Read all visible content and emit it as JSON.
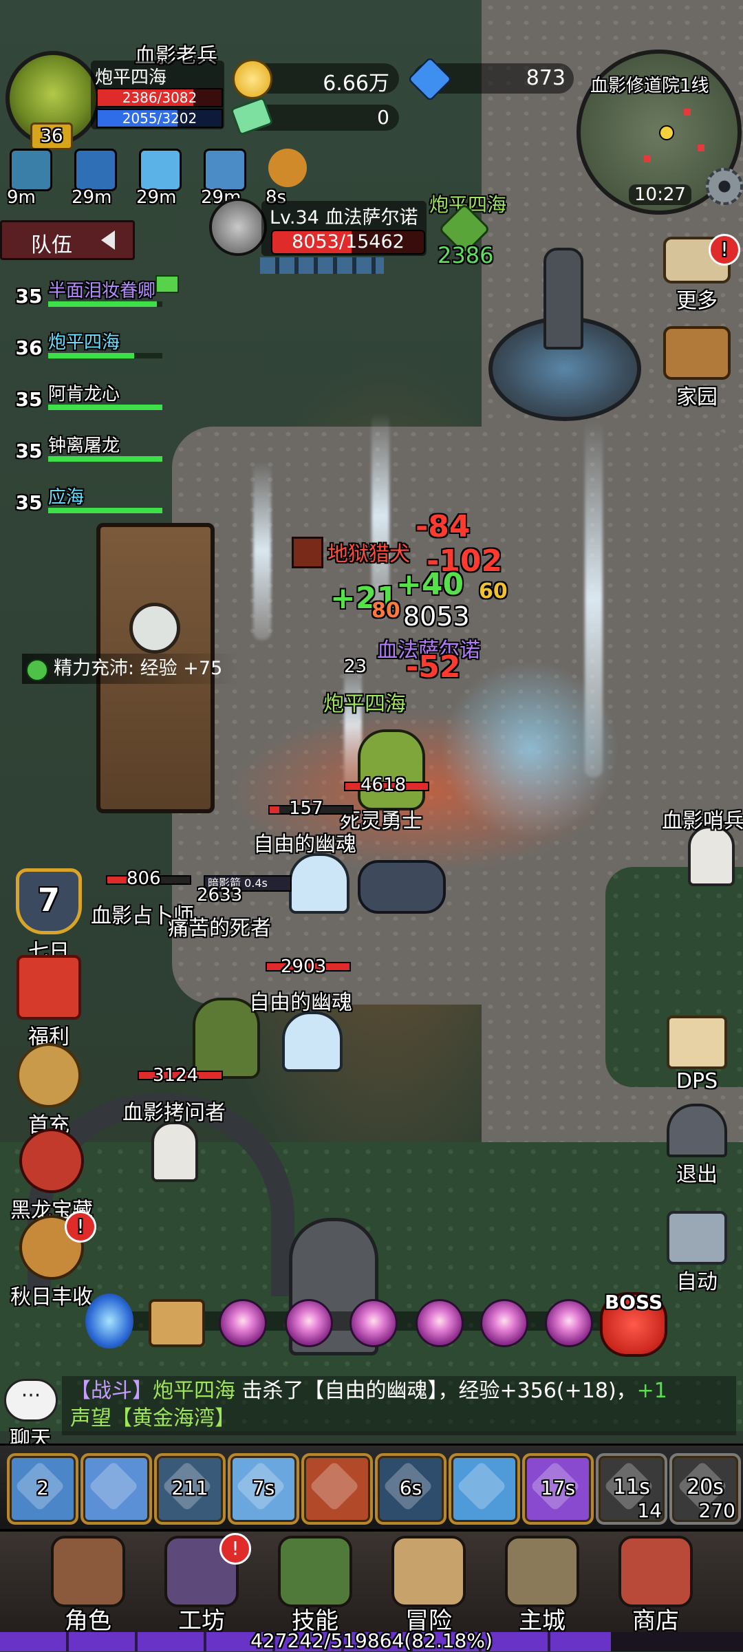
{
  "player": {
    "title": "血影老兵",
    "name": "炮平四海",
    "level": "36",
    "hp": "2386/3082",
    "hp_ratio": 0.774,
    "mp": "2055/3202",
    "mp_ratio": 0.642
  },
  "currency": {
    "gold": "6.66万",
    "gems": "873",
    "ticket": "0"
  },
  "buffs": [
    {
      "icon": "tentacle-icon",
      "time": "9m"
    },
    {
      "icon": "eye-icon",
      "time": "29m"
    },
    {
      "icon": "crystal-icon",
      "time": "29m"
    },
    {
      "icon": "scroll-icon",
      "time": "29m"
    },
    {
      "icon": "horn-icon",
      "time": "8s"
    }
  ],
  "target": {
    "label": "Lv.34 血法萨尔诺",
    "hp": "8053/15462",
    "hp_ratio": 0.521
  },
  "ally_marker": {
    "name": "炮平四海",
    "value": "2386"
  },
  "minimap": {
    "location": "血影修道院1线",
    "time": "10:27"
  },
  "team": {
    "tab_label": "队伍",
    "members": [
      {
        "level": "35",
        "name": "半面泪妆眷卿",
        "hp_ratio": 0.95,
        "color": "#b58cff"
      },
      {
        "level": "36",
        "name": "炮平四海",
        "hp_ratio": 0.75,
        "color": "#67e0ff"
      },
      {
        "level": "35",
        "name": "阿肯龙心",
        "hp_ratio": 1.0,
        "color": "#ffffff"
      },
      {
        "level": "35",
        "name": "钟离屠龙",
        "hp_ratio": 1.0,
        "color": "#ffffff"
      },
      {
        "level": "35",
        "name": "应海",
        "hp_ratio": 1.0,
        "color": "#67e0ff"
      }
    ]
  },
  "right_menu": {
    "more": "更多",
    "home": "家园",
    "dps": "DPS",
    "exit": "退出",
    "auto": "自动"
  },
  "left_menu": {
    "seven_days": "七日",
    "seven_days_num": "7",
    "welfare": "福利",
    "first_charge": "首充",
    "dragon_treasure": "黑龙宝藏",
    "autumn_harvest": "秋日丰收"
  },
  "energy_notice": "精力充沛: 经验 +75",
  "battlefield": {
    "labels": [
      {
        "id": "enemy-name-skeleton-top",
        "text": "血影哨兵"
      },
      {
        "id": "enemy-name-ghost-1",
        "text": "自由的幽魂"
      },
      {
        "id": "enemy-name-ghost-2",
        "text": "自由的幽魂"
      },
      {
        "id": "enemy-name-undead-warrior",
        "text": "死灵勇士"
      },
      {
        "id": "enemy-name-dead",
        "text": "痛苦的死者"
      },
      {
        "id": "enemy-name-torturer",
        "text": "血影拷问者"
      },
      {
        "id": "enemy-name-diviner",
        "text": "血影占卜师"
      },
      {
        "id": "ally-name-player",
        "text": "炮平四海"
      },
      {
        "id": "enemy-name-boss",
        "text": "血法萨尔诺"
      },
      {
        "id": "enemy-name-hellhound",
        "text": "地狱猎犬"
      }
    ],
    "hp_numbers": [
      "4618",
      "157",
      "806",
      "2633",
      "2903",
      "3124",
      "8053",
      "23"
    ],
    "damage_numbers": [
      "-84",
      "-102",
      "+40",
      "+21",
      "-52",
      "60",
      "80"
    ],
    "cast_label": "暗影箭 0.4s"
  },
  "wave_tracker": {
    "boss_label": "BOSS"
  },
  "chat": {
    "button_label": "聊天",
    "channel": "【战斗】",
    "speaker": "炮平四海",
    "text1": " 击杀了【自由的幽魂】，经验+356(+18)，",
    "bonus": "+1",
    "text2": "声望【黄金海湾】"
  },
  "skills": [
    {
      "icon": "dagger-icon",
      "label": "2"
    },
    {
      "icon": "spear-icon",
      "label": ""
    },
    {
      "icon": "claw-icon",
      "label": "211"
    },
    {
      "icon": "blade-icon",
      "label": "7s"
    },
    {
      "icon": "target-icon",
      "label": ""
    },
    {
      "icon": "whirl-icon",
      "label": "6s"
    },
    {
      "icon": "whistle-icon",
      "label": ""
    },
    {
      "icon": "rune-icon",
      "label": "17s"
    },
    {
      "icon": "potion-icon",
      "label": "11s",
      "count": "14"
    },
    {
      "icon": "elixir-icon",
      "label": "20s",
      "count": "270"
    }
  ],
  "nav": [
    {
      "icon": "character-icon",
      "label": "角色"
    },
    {
      "icon": "workshop-icon",
      "label": "工坊"
    },
    {
      "icon": "skill-book-icon",
      "label": "技能"
    },
    {
      "icon": "adventure-icon",
      "label": "冒险"
    },
    {
      "icon": "main-city-icon",
      "label": "主城"
    },
    {
      "icon": "shop-icon",
      "label": "商店"
    }
  ],
  "experience": {
    "text": "427242/519864(82.18%)",
    "ratio": 0.8218
  },
  "colors": {
    "hp_red": "#e02b2b",
    "mp_blue": "#2f6de8",
    "exp_purple": "#6a33c8",
    "ally_green": "#3ee04a",
    "gold": "#f5c21b"
  }
}
